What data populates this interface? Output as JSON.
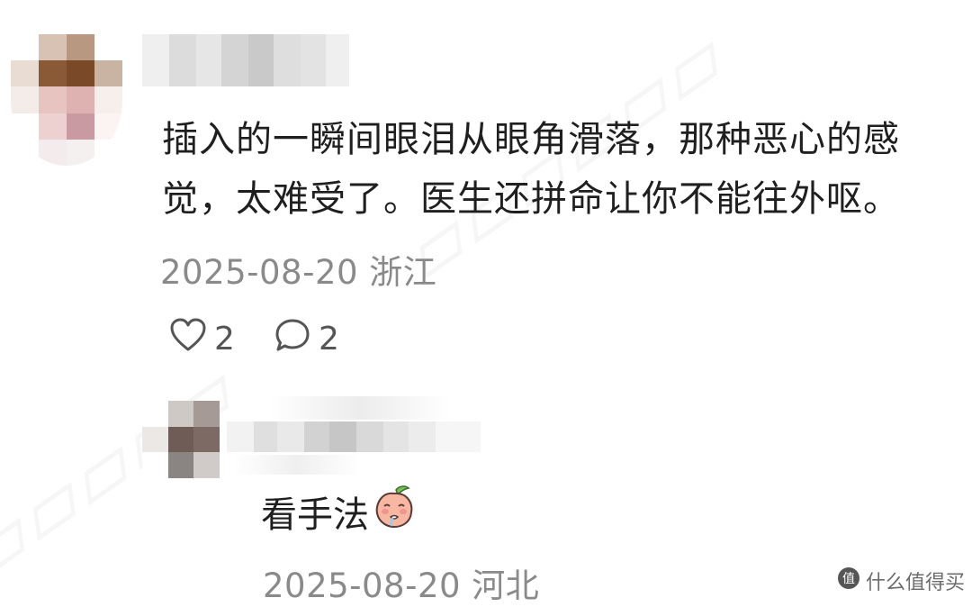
{
  "comment": {
    "text": "插入的一瞬间眼泪从眼角滑落，那种恶心的感觉，太难受了。医生还拼命让你不能往外呕。",
    "date": "2025-08-20",
    "location": "浙江",
    "likes": "2",
    "replies": "2"
  },
  "reply": {
    "text": "看手法",
    "emoji": "peach-face-emoji",
    "date": "2025-08-20",
    "location": "河北"
  },
  "brand": {
    "text": "什么值得买",
    "icon": "smzdm-logo-icon"
  },
  "colors": {
    "meta": "#8a8a8a",
    "text": "#1f1f1f"
  }
}
